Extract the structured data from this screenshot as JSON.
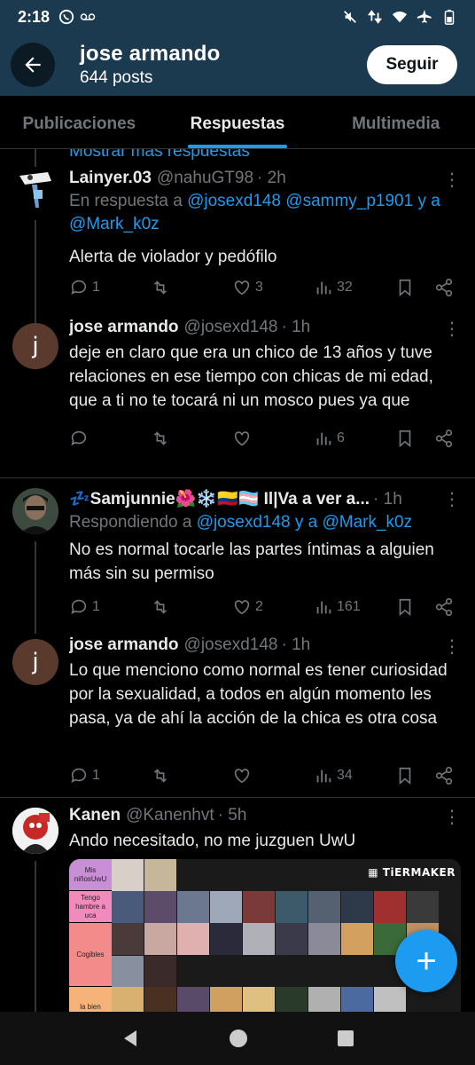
{
  "status_bar": {
    "time": "2:18"
  },
  "header": {
    "name": "jose armando",
    "posts": "644 posts",
    "follow_label": "Seguir"
  },
  "tabs": [
    {
      "label": "Publicaciones",
      "active": false
    },
    {
      "label": "Respuestas",
      "active": true
    },
    {
      "label": "Multimedia",
      "active": false
    }
  ],
  "feed": {
    "show_more": "Mostrar más respuestas",
    "tweets": [
      {
        "name": "Lainyer.03",
        "handle": "@nahuGT98",
        "time": "· 2h",
        "reply_prefix": "En respuesta a ",
        "reply_targets": "@josexd148 @sammy_p1901 y a @Mark_k0z",
        "text": "Alerta de violador y pedófilo",
        "replies": "1",
        "retweets": "",
        "likes": "3",
        "views": "32"
      },
      {
        "name": "jose armando",
        "handle": "@josexd148",
        "time": "· 1h",
        "avatar_letter": "j",
        "text": "deje en claro que era un chico de 13 años y tuve relaciones en ese tiempo con chicas de mi edad, que a ti no te tocará ni un mosco pues ya que",
        "replies": "",
        "retweets": "",
        "likes": "",
        "views": "6"
      },
      {
        "name": "💤Samjunnie🌺❄️🇨🇴🏳️‍⚧️ Il|Va a ver a...",
        "handle": "",
        "time": "· 1h",
        "reply_prefix": "Respondiendo a ",
        "reply_targets": "@josexd148 y a @Mark_k0z",
        "text": "No es normal tocarle las partes íntimas a alguien más sin su permiso",
        "replies": "1",
        "retweets": "",
        "likes": "2",
        "views": "161"
      },
      {
        "name": "jose armando",
        "handle": "@josexd148",
        "time": "· 1h",
        "avatar_letter": "j",
        "text": "Lo que menciono como normal es tener curiosidad por la sexualidad, a todos en algún momento les pasa, ya de ahí la acción de la chica es otra cosa",
        "replies": "1",
        "retweets": "",
        "likes": "",
        "views": "34"
      },
      {
        "name": "Kanen",
        "handle": "@Kanenhvt",
        "time": "· 5h",
        "text": "Ando necesitado, no me juzguen UwU",
        "image": {
          "logo": "TiERMAKER",
          "tiers": [
            {
              "label": "Mis niñosUwU",
              "color": "#c98fd6"
            },
            {
              "label": "Tengo hambre a uca",
              "color": "#f28bbd"
            },
            {
              "label": "Cogibles",
              "color": "#f38b8b"
            },
            {
              "label": "la bien",
              "color": "#f5b37a"
            }
          ]
        }
      }
    ]
  }
}
